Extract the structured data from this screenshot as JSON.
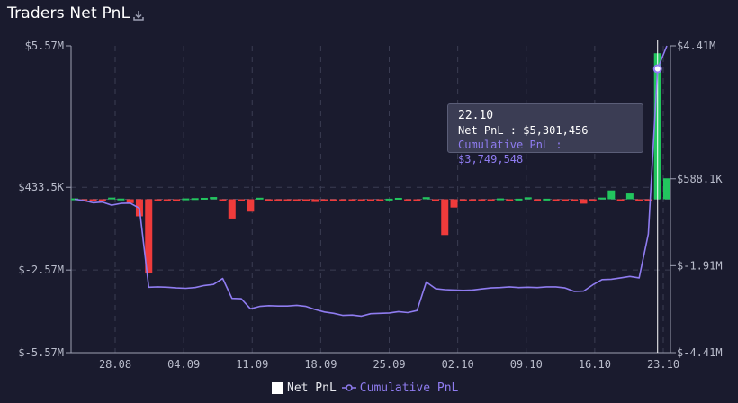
{
  "header": {
    "title": "Traders Net PnL",
    "download_icon": "download-icon"
  },
  "colors": {
    "background": "#1a1b2e",
    "positive": "#22c55e",
    "negative": "#ef3b3b",
    "cumulative": "#8f7cf0",
    "grid": "#3a3c52"
  },
  "tooltip": {
    "date": "22.10",
    "net_label": "Net PnL : $5,301,456",
    "cum_label": "Cumulative PnL : $3,749,548"
  },
  "legend": {
    "net": "Net PnL",
    "cum": "Cumulative PnL"
  },
  "chart_data": {
    "type": "bar",
    "x_tick_labels": [
      "28.08",
      "04.09",
      "11.09",
      "18.09",
      "25.09",
      "02.10",
      "09.10",
      "16.10",
      "23.10"
    ],
    "left_axis": {
      "ticks": [
        "$5.57M",
        "$433.5K",
        "$-2.57M",
        "$-5.57M"
      ],
      "values": [
        5570000,
        433500,
        -2570000,
        -5570000
      ]
    },
    "right_axis": {
      "ticks": [
        "$4.41M",
        "$588.1K",
        "$-1.91M",
        "$-4.41M"
      ],
      "values": [
        4410000,
        588100,
        -1910000,
        -4410000
      ]
    },
    "series": [
      {
        "name": "Net PnL",
        "type": "bar",
        "values": [
          30000,
          -50000,
          -40000,
          -70000,
          60000,
          25000,
          -140000,
          -620000,
          -2680000,
          -20000,
          -25000,
          -20000,
          30000,
          40000,
          50000,
          80000,
          -40000,
          -700000,
          -40000,
          -450000,
          55000,
          -30000,
          -15000,
          -25000,
          -30000,
          -5000,
          -100000,
          -40000,
          -35000,
          -50000,
          -20000,
          -15000,
          -60000,
          -20000,
          20000,
          50000,
          -25000,
          -25000,
          75000,
          -40000,
          -1300000,
          -300000,
          -50000,
          -10000,
          -30000,
          -10000,
          30000,
          -20000,
          20000,
          70000,
          -20000,
          20000,
          -40000,
          -30000,
          -10000,
          -160000,
          -35000,
          60000,
          320000,
          -25000,
          210000,
          -15000,
          -10000,
          5301456,
          760000
        ]
      },
      {
        "name": "Cumulative PnL",
        "type": "line",
        "values": [
          0,
          -40000,
          -100000,
          -80000,
          -170000,
          -120000,
          -110000,
          -260000,
          -2530000,
          -2520000,
          -2530000,
          -2550000,
          -2560000,
          -2540000,
          -2480000,
          -2450000,
          -2280000,
          -2850000,
          -2860000,
          -3150000,
          -3080000,
          -3060000,
          -3070000,
          -3070000,
          -3050000,
          -3080000,
          -3170000,
          -3240000,
          -3280000,
          -3340000,
          -3330000,
          -3360000,
          -3290000,
          -3280000,
          -3270000,
          -3230000,
          -3260000,
          -3200000,
          -2380000,
          -2570000,
          -2600000,
          -2610000,
          -2620000,
          -2610000,
          -2580000,
          -2550000,
          -2540000,
          -2520000,
          -2540000,
          -2530000,
          -2540000,
          -2520000,
          -2520000,
          -2550000,
          -2650000,
          -2640000,
          -2460000,
          -2310000,
          -2300000,
          -2260000,
          -2220000,
          -2260000,
          -1000000,
          3749548,
          4410000
        ]
      }
    ],
    "highlight": {
      "x": "22.10"
    },
    "grid": true,
    "legend_position": "bottom-center"
  }
}
